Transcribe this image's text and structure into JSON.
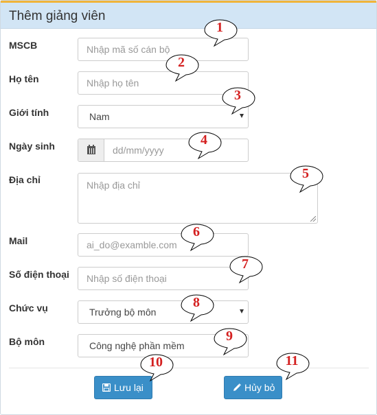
{
  "panel": {
    "title": "Thêm giảng viên"
  },
  "form": {
    "mscb": {
      "label": "MSCB",
      "placeholder": "Nhập mã số cán bộ"
    },
    "hoten": {
      "label": "Họ tên",
      "placeholder": "Nhập họ tên"
    },
    "gioitinh": {
      "label": "Giới tính",
      "value": "Nam"
    },
    "ngaysinh": {
      "label": "Ngày sinh",
      "placeholder": "dd/mm/yyyy"
    },
    "diachi": {
      "label": "Địa chỉ",
      "placeholder": "Nhập địa chỉ"
    },
    "mail": {
      "label": "Mail",
      "placeholder": "ai_do@examble.com"
    },
    "sodienthoai": {
      "label": "Số điện thoại",
      "placeholder": "Nhập số điện thoại"
    },
    "chucvu": {
      "label": "Chức vụ",
      "value": "Trưởng bộ môn"
    },
    "bomon": {
      "label": "Bộ môn",
      "value": "Công nghệ phần mềm"
    }
  },
  "buttons": {
    "save": {
      "label": "Lưu lại",
      "icon": "save-icon"
    },
    "cancel": {
      "label": "Hủy bỏ",
      "icon": "pencil-icon"
    }
  },
  "callouts": [
    "1",
    "2",
    "3",
    "4",
    "5",
    "6",
    "7",
    "8",
    "9",
    "10",
    "11"
  ],
  "colors": {
    "header_bg": "#d2e5f5",
    "header_accent": "#f0b43a",
    "button": "#3a8fc8",
    "callout_number": "#d42020"
  }
}
